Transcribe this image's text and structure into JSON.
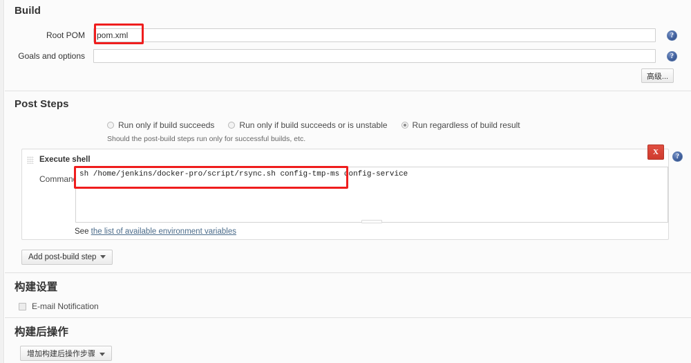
{
  "sections": {
    "build": {
      "title": "Build"
    },
    "post_steps": {
      "title": "Post Steps"
    },
    "build_settings": {
      "title": "构建设置"
    },
    "post_build_actions": {
      "title": "构建后操作"
    }
  },
  "build": {
    "root_pom": {
      "label": "Root POM",
      "value": "pom.xml",
      "help_glyph": "?"
    },
    "goals_and_options": {
      "label": "Goals and options",
      "value": "",
      "help_glyph": "?"
    },
    "advanced_button": "高级..."
  },
  "post_steps": {
    "radios": [
      {
        "label": "Run only if build succeeds",
        "selected": false
      },
      {
        "label": "Run only if build succeeds or is unstable",
        "selected": false
      },
      {
        "label": "Run regardless of build result",
        "selected": true
      }
    ],
    "hint": "Should the post-build steps run only for successful builds, etc.",
    "step": {
      "title": "Execute shell",
      "delete_label": "X",
      "help_glyph": "?",
      "command_label": "Command",
      "command_value": "sh /home/jenkins/docker-pro/script/rsync.sh config-tmp-ms config-service",
      "see_prefix": "See ",
      "see_link": "the list of available environment variables"
    },
    "add_step_button": "Add post-build step"
  },
  "build_settings": {
    "email_notification": {
      "label": "E-mail Notification",
      "checked": false
    }
  },
  "post_build_actions": {
    "add_button": "增加构建后操作步骤"
  },
  "colors": {
    "annotation": "#ef1d1d",
    "delete_button": "#cf3b2e",
    "help_icon": "#42629f",
    "link": "#4a6b8a"
  },
  "annotations": [
    {
      "name": "root-pom-highlight"
    },
    {
      "name": "command-highlight"
    }
  ]
}
